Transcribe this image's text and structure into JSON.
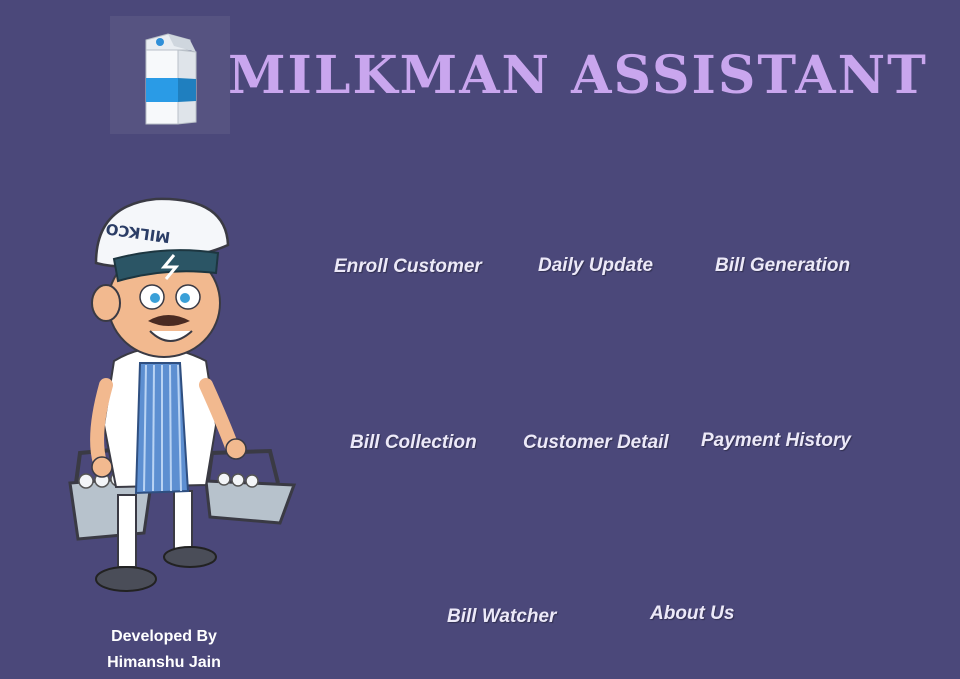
{
  "app": {
    "title": "MILKMAN ASSISTANT"
  },
  "menu": {
    "enroll_customer": "Enroll Customer",
    "daily_update": "Daily Update",
    "bill_generation": "Bill Generation",
    "bill_collection": "Bill Collection",
    "customer_detail": "Customer Detail",
    "payment_history": "Payment History",
    "bill_watcher": "Bill Watcher",
    "about_us": "About Us"
  },
  "footer": {
    "line1": "Developed By",
    "line2": "Himanshu Jain"
  },
  "illustration": {
    "cap_text": "MILKCO"
  },
  "icons": {
    "logo": "milk-carton-icon",
    "mascot": "milkman-illustration"
  },
  "colors": {
    "background": "#4b487a",
    "title": "#c9a6ee",
    "menu_text": "#ece9f8"
  }
}
